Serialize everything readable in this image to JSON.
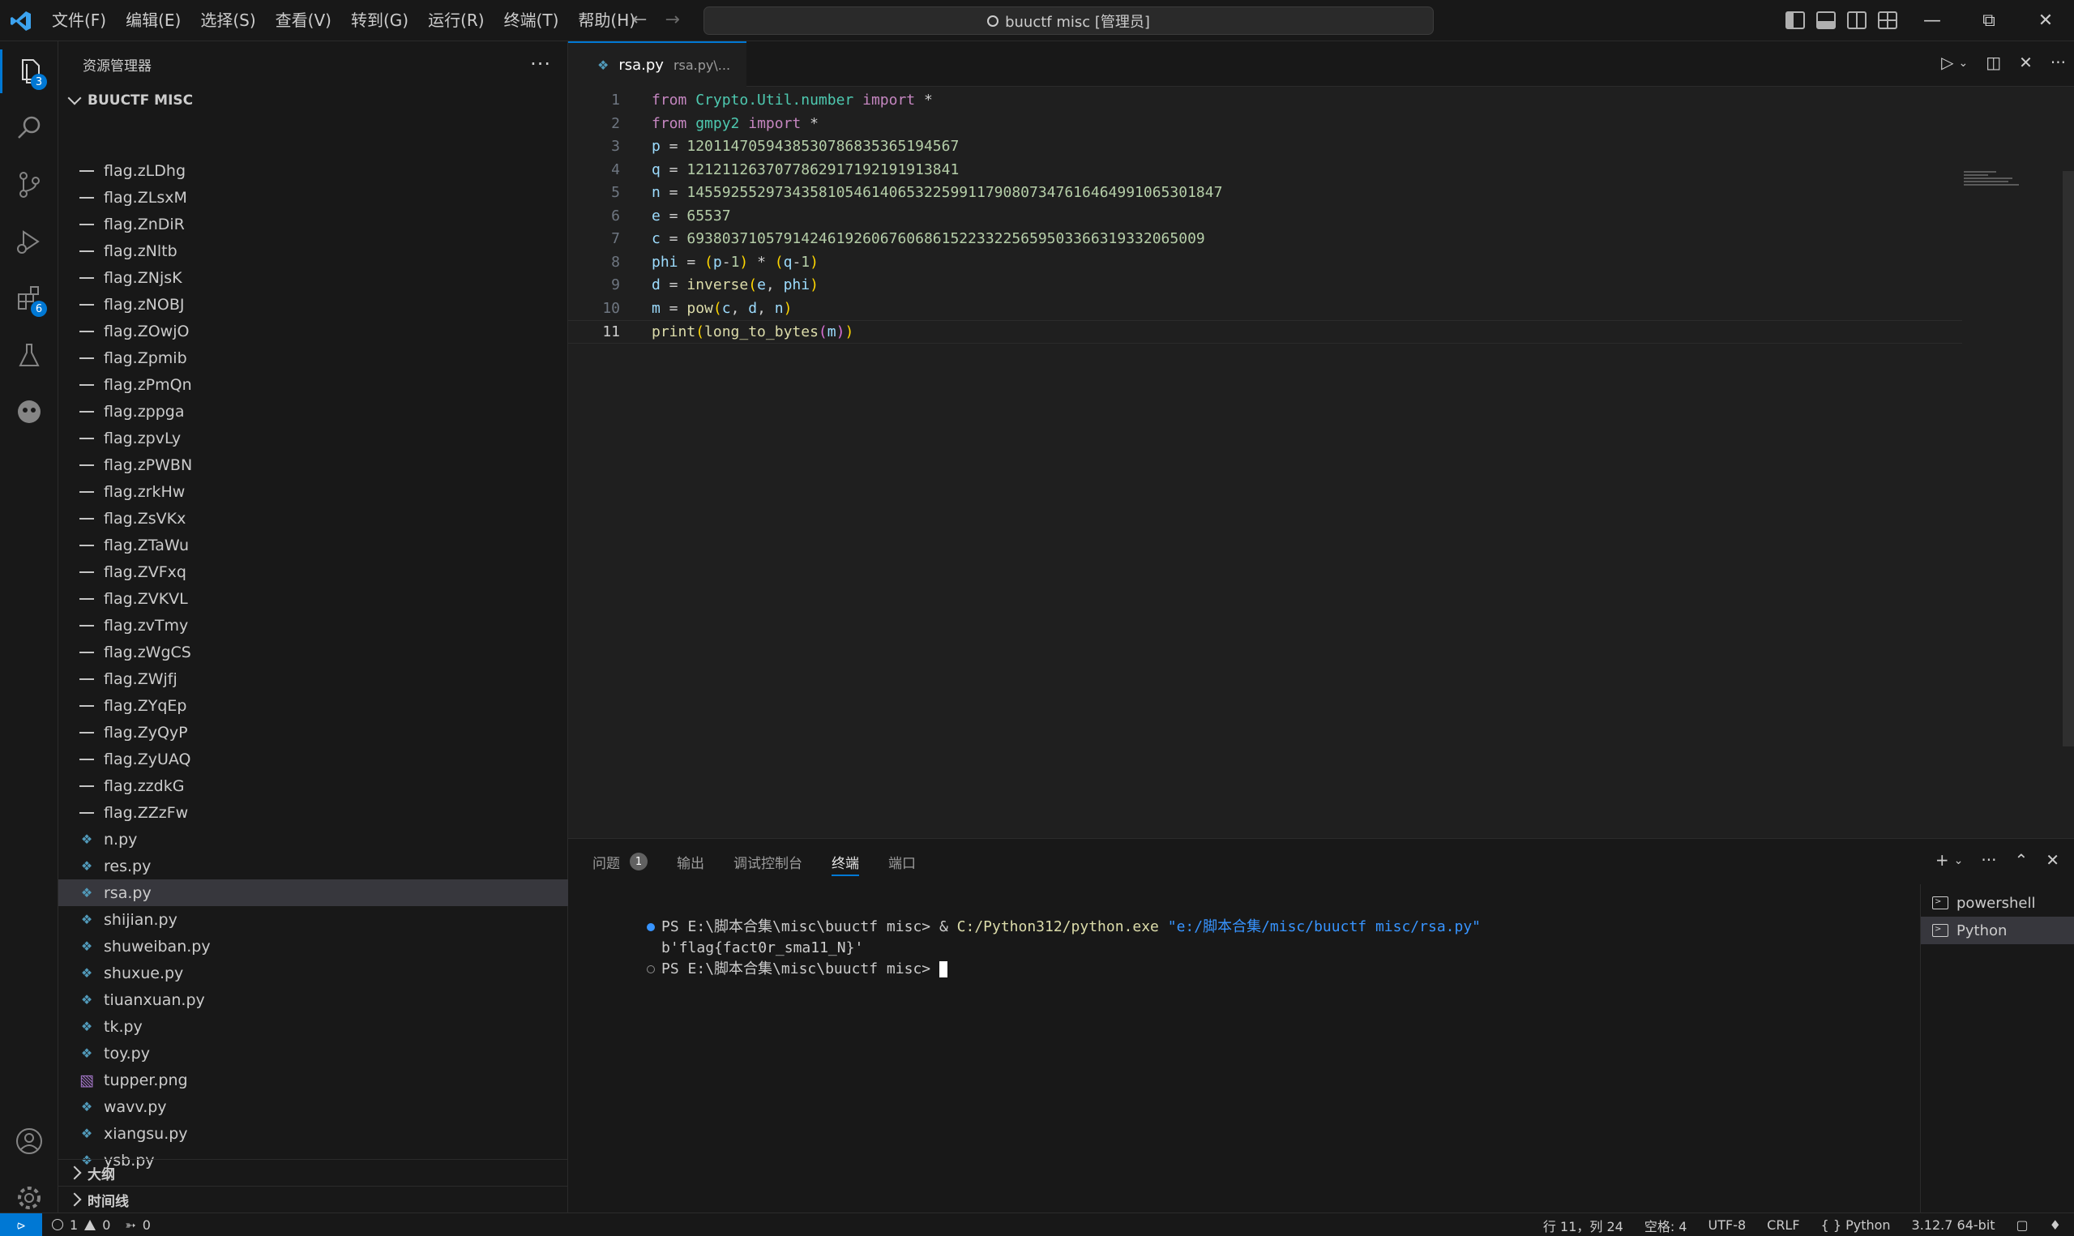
{
  "window": {
    "title": "buuctf misc [管理员]"
  },
  "menu": [
    "文件(F)",
    "编辑(E)",
    "选择(S)",
    "查看(V)",
    "转到(G)",
    "运行(R)",
    "终端(T)",
    "帮助(H)"
  ],
  "activity_bar": {
    "explorer_badge": "3",
    "extensions_badge": "6"
  },
  "sidebar": {
    "header": "资源管理器",
    "folder": "BUUCTF MISC",
    "files": [
      {
        "name": "flag.zLDhg",
        "type": "txt"
      },
      {
        "name": "flag.ZLsxM",
        "type": "txt"
      },
      {
        "name": "flag.ZnDiR",
        "type": "txt"
      },
      {
        "name": "flag.zNltb",
        "type": "txt"
      },
      {
        "name": "flag.ZNjsK",
        "type": "txt"
      },
      {
        "name": "flag.zNOBJ",
        "type": "txt"
      },
      {
        "name": "flag.ZOwjO",
        "type": "txt"
      },
      {
        "name": "flag.Zpmib",
        "type": "txt"
      },
      {
        "name": "flag.zPmQn",
        "type": "txt"
      },
      {
        "name": "flag.zppga",
        "type": "txt"
      },
      {
        "name": "flag.zpvLy",
        "type": "txt"
      },
      {
        "name": "flag.zPWBN",
        "type": "txt"
      },
      {
        "name": "flag.zrkHw",
        "type": "txt"
      },
      {
        "name": "flag.ZsVKx",
        "type": "txt"
      },
      {
        "name": "flag.ZTaWu",
        "type": "txt"
      },
      {
        "name": "flag.ZVFxq",
        "type": "txt"
      },
      {
        "name": "flag.ZVKVL",
        "type": "txt"
      },
      {
        "name": "flag.zvTmy",
        "type": "txt"
      },
      {
        "name": "flag.zWgCS",
        "type": "txt"
      },
      {
        "name": "flag.ZWjfj",
        "type": "txt"
      },
      {
        "name": "flag.ZYqEp",
        "type": "txt"
      },
      {
        "name": "flag.ZyQyP",
        "type": "txt"
      },
      {
        "name": "flag.ZyUAQ",
        "type": "txt"
      },
      {
        "name": "flag.zzdkG",
        "type": "txt"
      },
      {
        "name": "flag.ZZzFw",
        "type": "txt"
      },
      {
        "name": "n.py",
        "type": "py"
      },
      {
        "name": "res.py",
        "type": "py"
      },
      {
        "name": "rsa.py",
        "type": "py"
      },
      {
        "name": "shijian.py",
        "type": "py"
      },
      {
        "name": "shuweiban.py",
        "type": "py"
      },
      {
        "name": "shuxue.py",
        "type": "py"
      },
      {
        "name": "tiuanxuan.py",
        "type": "py"
      },
      {
        "name": "tk.py",
        "type": "py"
      },
      {
        "name": "toy.py",
        "type": "py"
      },
      {
        "name": "tupper.png",
        "type": "png"
      },
      {
        "name": "wavv.py",
        "type": "py"
      },
      {
        "name": "xiangsu.py",
        "type": "py"
      },
      {
        "name": "ysb.py",
        "type": "py"
      }
    ],
    "selected_file": "rsa.py",
    "outline": "大纲",
    "timeline": "时间线"
  },
  "editor": {
    "tab": {
      "name": "rsa.py",
      "path": "rsa.py\\..."
    },
    "current_line": 11,
    "lines": [
      [
        [
          "kw",
          "from"
        ],
        [
          "",
          ""
        ],
        [
          " ",
          ""
        ],
        [
          "mod",
          "Crypto.Util.number"
        ],
        [
          "",
          ""
        ],
        [
          " ",
          ""
        ],
        [
          "kw",
          "import"
        ],
        [
          "",
          " *"
        ]
      ],
      [
        [
          "kw",
          "from"
        ],
        [
          " ",
          ""
        ],
        [
          "mod",
          "gmpy2"
        ],
        [
          " ",
          ""
        ],
        [
          "kw",
          "import"
        ],
        [
          "",
          " *"
        ]
      ],
      [
        [
          "var",
          "p"
        ],
        [
          "",
          " = "
        ],
        [
          "num",
          "12011470594385307868353651945​67"
        ]
      ],
      [
        [
          "var",
          "q"
        ],
        [
          "",
          " = "
        ],
        [
          "num",
          "1212112637077862917192191913841"
        ]
      ],
      [
        [
          "var",
          "n"
        ],
        [
          "",
          " = "
        ],
        [
          "num",
          "1455925529734358105461406532259911790807347616464991065301847"
        ]
      ],
      [
        [
          "var",
          "e"
        ],
        [
          "",
          " = "
        ],
        [
          "num",
          "65537"
        ]
      ],
      [
        [
          "var",
          "c"
        ],
        [
          "",
          " = "
        ],
        [
          "num",
          "693803710579142461926067606861522332256595033663193320650​09"
        ]
      ],
      [
        [
          "var",
          "phi"
        ],
        [
          "",
          " = "
        ],
        [
          "par1",
          "("
        ],
        [
          "var",
          "p"
        ],
        [
          "",
          "-"
        ],
        [
          "num",
          "1"
        ],
        [
          "par1",
          ")"
        ],
        [
          "",
          " * "
        ],
        [
          "par1",
          "("
        ],
        [
          "var",
          "q"
        ],
        [
          "",
          "-"
        ],
        [
          "num",
          "1"
        ],
        [
          "par1",
          ")"
        ]
      ],
      [
        [
          "var",
          "d"
        ],
        [
          "",
          " = "
        ],
        [
          "fn",
          "inverse"
        ],
        [
          "par1",
          "("
        ],
        [
          "var",
          "e"
        ],
        [
          "",
          ", "
        ],
        [
          "var",
          "phi"
        ],
        [
          "par1",
          ")"
        ]
      ],
      [
        [
          "var",
          "m"
        ],
        [
          "",
          " = "
        ],
        [
          "fn",
          "pow"
        ],
        [
          "par1",
          "("
        ],
        [
          "var",
          "c"
        ],
        [
          "",
          ", "
        ],
        [
          "var",
          "d"
        ],
        [
          "",
          ", "
        ],
        [
          "var",
          "n"
        ],
        [
          "par1",
          ")"
        ]
      ],
      [
        [
          "fn",
          "print"
        ],
        [
          "par1",
          "("
        ],
        [
          "fn",
          "long_to_bytes"
        ],
        [
          "par2",
          "("
        ],
        [
          "var",
          "m"
        ],
        [
          "par2",
          ")"
        ],
        [
          "par1",
          ")"
        ]
      ]
    ]
  },
  "panel": {
    "tabs": [
      {
        "label": "问题",
        "count": "1"
      },
      {
        "label": "输出"
      },
      {
        "label": "调试控制台"
      },
      {
        "label": "终端",
        "active": true
      },
      {
        "label": "端口"
      }
    ],
    "terminal": {
      "line1_prompt": "PS E:\\脚本合集\\misc\\buuctf misc> & ",
      "line1_cmd": "C:/Python312/python.exe",
      "line1_arg": " \"e:/脚本合集/misc/buuctf misc/rsa.py\"",
      "line2": "b'flag{fact0r_sma11_N}'",
      "line3_prompt": "PS E:\\脚本合集\\misc\\buuctf misc> "
    },
    "terminal_list": [
      "powershell",
      "Python"
    ]
  },
  "status_bar": {
    "errors": "1",
    "warnings": "0",
    "ports": "0",
    "position": "行 11，列 24",
    "spaces": "空格: 4",
    "encoding": "UTF-8",
    "eol": "CRLF",
    "language": "Python",
    "interpreter": "3.12.7 64-bit"
  }
}
